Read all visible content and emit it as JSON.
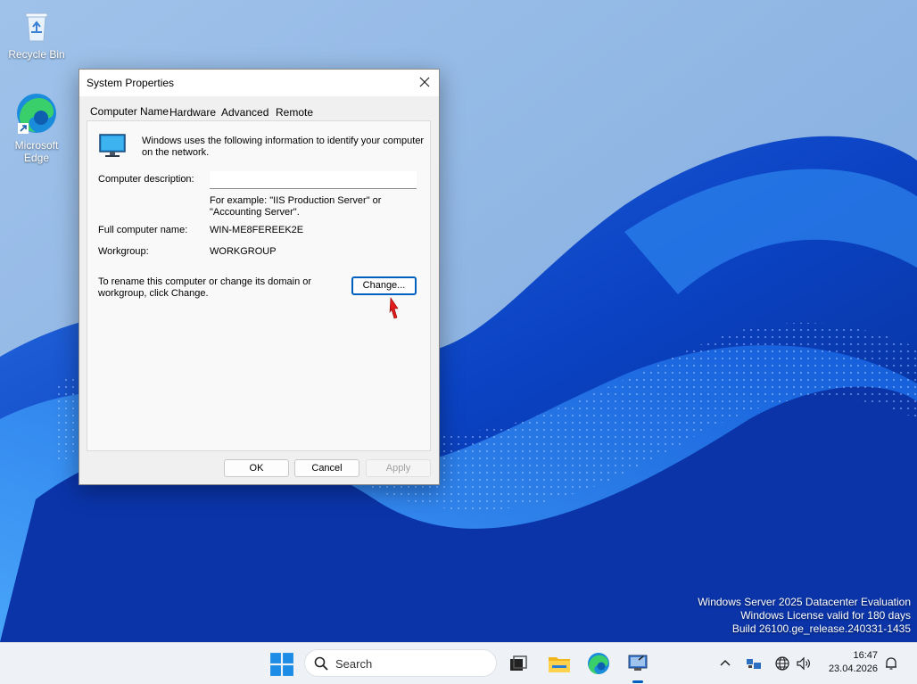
{
  "desktop": {
    "icons": [
      {
        "label": "Recycle Bin",
        "icon": "recycle-bin-icon"
      },
      {
        "label": "Microsoft Edge",
        "icon": "edge-icon"
      }
    ]
  },
  "dialog": {
    "title": "System Properties",
    "tabs": [
      "Computer Name",
      "Hardware",
      "Advanced",
      "Remote"
    ],
    "active_tab": "Computer Name",
    "intro": "Windows uses the following information to identify your computer on the network.",
    "description_label": "Computer description:",
    "description_value": "",
    "example": "For example: \"IIS Production Server\" or \"Accounting Server\".",
    "full_name_label": "Full computer name:",
    "full_name_value": "WIN-ME8FEREEK2E",
    "workgroup_label": "Workgroup:",
    "workgroup_value": "WORKGROUP",
    "rename_text": "To rename this computer or change its domain or workgroup, click Change.",
    "change_button": "Change...",
    "ok_button": "OK",
    "cancel_button": "Cancel",
    "apply_button": "Apply"
  },
  "watermark": {
    "line1": "Windows Server 2025 Datacenter Evaluation",
    "line2": "Windows License valid for 180 days",
    "line3": "Build 26100.ge_release.240331-1435"
  },
  "taskbar": {
    "search_label": "Search",
    "apps": [
      "start-icon",
      "task-view-icon",
      "file-explorer-icon",
      "edge-icon",
      "system-properties-icon"
    ],
    "tray": [
      "chevron-up-icon",
      "network-device-icon",
      "globe-icon",
      "speaker-icon",
      "notification-icon"
    ],
    "time": "16:47",
    "date": "23.04.2026"
  },
  "colors": {
    "accent": "#0060c0",
    "wallpaper_dark": "#0a3fb8",
    "wallpaper_light": "#9fc2ea"
  }
}
